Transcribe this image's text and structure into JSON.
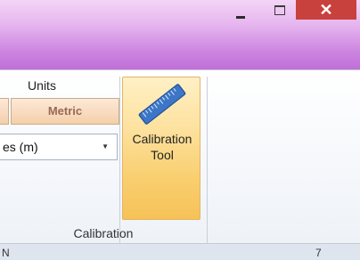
{
  "window": {
    "minimize_icon": "minimize-icon",
    "maximize_icon": "maximize-icon",
    "close_symbol": "✕",
    "close_color": "#c9413c",
    "title_gradient": [
      "#f3d5f6",
      "#c06fd8"
    ]
  },
  "ribbon": {
    "units": {
      "label": "Units",
      "metric_label": "Metric"
    },
    "dropdown": {
      "selected": "es (m)",
      "chevron": "▼"
    },
    "calibration_button": {
      "label_line1": "Calibration",
      "label_line2": "Tool",
      "icon": "ruler-icon"
    },
    "group_label": "Calibration"
  },
  "status": {
    "left_text": "N",
    "right_text": "7"
  }
}
